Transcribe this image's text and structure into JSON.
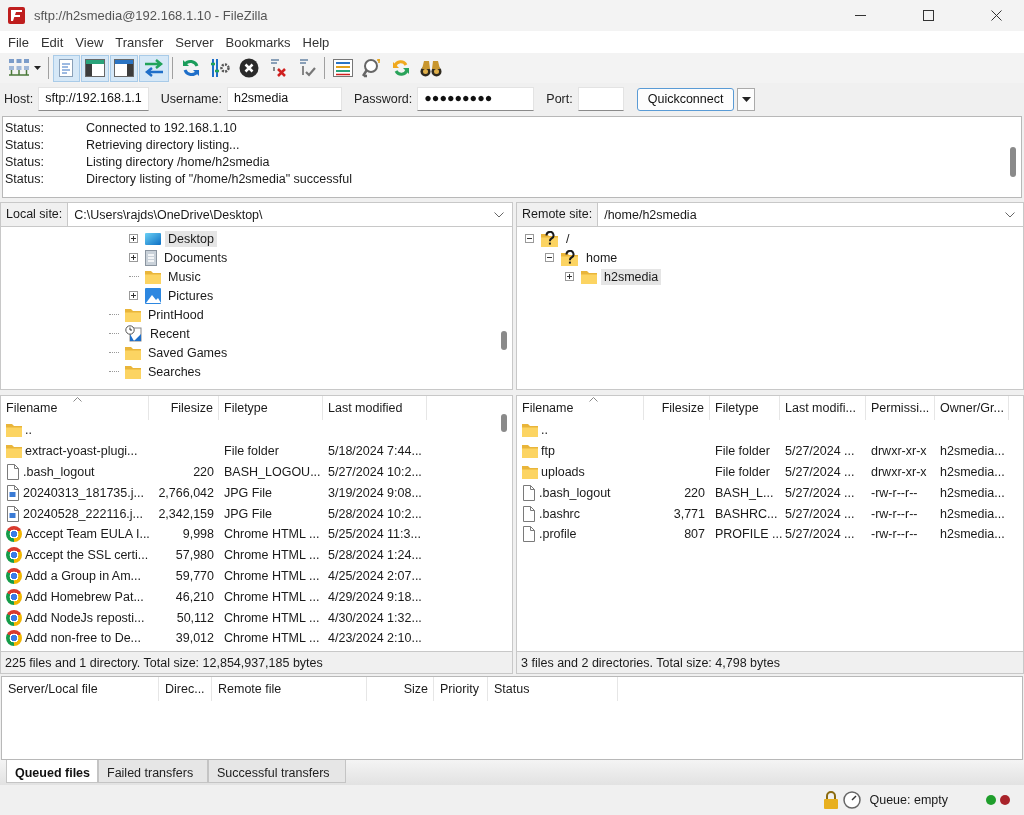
{
  "window": {
    "title": "sftp://h2smedia@192.168.1.10 - FileZilla"
  },
  "menu": [
    "File",
    "Edit",
    "View",
    "Transfer",
    "Server",
    "Bookmarks",
    "Help"
  ],
  "toolbar": [
    [
      {
        "pressed": false
      }
    ],
    [
      {
        "pressed": true
      },
      {
        "pressed": true
      },
      {
        "pressed": true
      },
      {
        "pressed": true
      }
    ],
    [
      {
        "pressed": false
      },
      {
        "pressed": false
      },
      {
        "pressed": false
      },
      {
        "pressed": false
      },
      {
        "pressed": false
      }
    ],
    [
      {
        "pressed": false
      },
      {
        "pressed": false
      },
      {
        "pressed": false
      },
      {
        "pressed": false
      }
    ]
  ],
  "quickconnect": {
    "fields": [
      {
        "label": "Host:",
        "value": "sftp://192.168.1.1"
      },
      {
        "label": "Username:",
        "value": "h2smedia"
      },
      {
        "label": "Password:",
        "value": "●●●●●●●●●"
      },
      {
        "label": "Port:"
      }
    ],
    "button": "Quickconnect"
  },
  "message_log": [
    {
      "label": "Status:",
      "text": "Connected to 192.168.1.10"
    },
    {
      "label": "Status:",
      "text": "Retrieving directory listing..."
    },
    {
      "label": "Status:",
      "text": "Listing directory /home/h2smedia"
    },
    {
      "label": "Status:",
      "text": "Directory listing of \"/home/h2smedia\" successful"
    }
  ],
  "local": {
    "site_label": "Local site:",
    "path": "C:\\Users\\rajds\\OneDrive\\Desktop\\",
    "tree": [
      {
        "children": [
          {
            "label": "Desktop",
            "kind": "desktop",
            "expandable": true,
            "expanded": false,
            "selected": true
          },
          {
            "label": "Documents",
            "kind": "documents",
            "expandable": true,
            "expanded": false,
            "selected": false
          },
          {
            "label": "Music",
            "kind": "folder",
            "expandable": false,
            "selected": false
          },
          {
            "label": "Pictures",
            "kind": "pictures",
            "expandable": true,
            "expanded": false,
            "selected": false
          }
        ]
      },
      {
        "label": "PrintHood",
        "kind": "folder",
        "expandable": false,
        "selected": false
      },
      {
        "label": "Recent",
        "kind": "recent",
        "expandable": false,
        "selected": false
      },
      {
        "label": "Saved Games",
        "kind": "folder",
        "expandable": false,
        "selected": false
      },
      {
        "label": "Searches",
        "kind": "folder",
        "expandable": false,
        "selected": false
      }
    ],
    "columns": [
      "Filename",
      "Filesize",
      "Filetype",
      "Last modified"
    ],
    "rows": [
      {
        "kind": "folder",
        "name": ".."
      },
      {
        "kind": "folder",
        "name": "extract-yoast-plugi...",
        "type": "File folder",
        "modified": "5/18/2024 7:44..."
      },
      {
        "kind": "file",
        "name": ".bash_logout",
        "size": "220",
        "type": "BASH_LOGOU...",
        "modified": "5/27/2024 10:2..."
      },
      {
        "kind": "image",
        "name": "20240313_181735.j...",
        "size": "2,766,042",
        "type": "JPG File",
        "modified": "3/19/2024 9:08..."
      },
      {
        "kind": "image",
        "name": "20240528_222116.j...",
        "size": "2,342,159",
        "type": "JPG File",
        "modified": "5/28/2024 10:2..."
      },
      {
        "kind": "html",
        "name": "Accept Team EULA I...",
        "size": "9,998",
        "type": "Chrome HTML ...",
        "modified": "5/25/2024 11:3..."
      },
      {
        "kind": "html",
        "name": "Accept the SSL certi...",
        "size": "57,980",
        "type": "Chrome HTML ...",
        "modified": "5/28/2024 1:24..."
      },
      {
        "kind": "html",
        "name": "Add a Group in Am...",
        "size": "59,770",
        "type": "Chrome HTML ...",
        "modified": "4/25/2024 2:07..."
      },
      {
        "kind": "html",
        "name": "Add Homebrew Pat...",
        "size": "46,210",
        "type": "Chrome HTML ...",
        "modified": "4/29/2024 9:18..."
      },
      {
        "kind": "html",
        "name": "Add NodeJs reposti...",
        "size": "50,112",
        "type": "Chrome HTML ...",
        "modified": "4/30/2024 1:32..."
      },
      {
        "kind": "html",
        "name": "Add non-free to De...",
        "size": "39,012",
        "type": "Chrome HTML ...",
        "modified": "4/23/2024 2:10..."
      }
    ],
    "summary": "225 files and 1 directory. Total size: 12,854,937,185 bytes"
  },
  "remote": {
    "site_label": "Remote site:",
    "path": "/home/h2smedia",
    "tree": [
      {
        "label": "/",
        "kind": "unknown",
        "expandable": true,
        "expanded": true,
        "selected": false,
        "children": [
          {
            "label": "home",
            "kind": "unknown",
            "expandable": true,
            "expanded": true,
            "selected": false,
            "children": [
              {
                "label": "h2smedia",
                "kind": "folder",
                "expandable": true,
                "expanded": false,
                "selected": true
              }
            ]
          }
        ]
      }
    ],
    "columns": [
      "Filename",
      "Filesize",
      "Filetype",
      "Last modifi...",
      "Permissi...",
      "Owner/Gr..."
    ],
    "rows": [
      {
        "kind": "folder",
        "name": ".."
      },
      {
        "kind": "folder",
        "name": "ftp",
        "type": "File folder",
        "modified": "5/27/2024 ...",
        "permissions": "drwxr-xr-x",
        "owner": "h2smedia..."
      },
      {
        "kind": "folder",
        "name": "uploads",
        "type": "File folder",
        "modified": "5/27/2024 ...",
        "permissions": "drwxr-xr-x",
        "owner": "h2smedia..."
      },
      {
        "kind": "file",
        "name": ".bash_logout",
        "size": "220",
        "type": "BASH_L...",
        "modified": "5/27/2024 ...",
        "permissions": "-rw-r--r--",
        "owner": "h2smedia..."
      },
      {
        "kind": "file",
        "name": ".bashrc",
        "size": "3,771",
        "type": "BASHRC...",
        "modified": "5/27/2024 ...",
        "permissions": "-rw-r--r--",
        "owner": "h2smedia..."
      },
      {
        "kind": "file",
        "name": ".profile",
        "size": "807",
        "type": "PROFILE ...",
        "modified": "5/27/2024 ...",
        "permissions": "-rw-r--r--",
        "owner": "h2smedia..."
      }
    ],
    "summary": "3 files and 2 directories. Total size: 4,798 bytes"
  },
  "queue": {
    "columns": [
      "Server/Local file",
      "Direc...",
      "Remote file",
      "Size",
      "Priority",
      "Status"
    ],
    "tabs": [
      {
        "label": "Queued files",
        "selected": true
      },
      {
        "label": "Failed transfers",
        "selected": false
      },
      {
        "label": "Successful transfers",
        "selected": false
      }
    ]
  },
  "status_bar": {
    "queue": "Queue: empty",
    "leds": [
      {
        "color": "#1f9e2c"
      },
      {
        "color": "#a8232a"
      }
    ]
  }
}
